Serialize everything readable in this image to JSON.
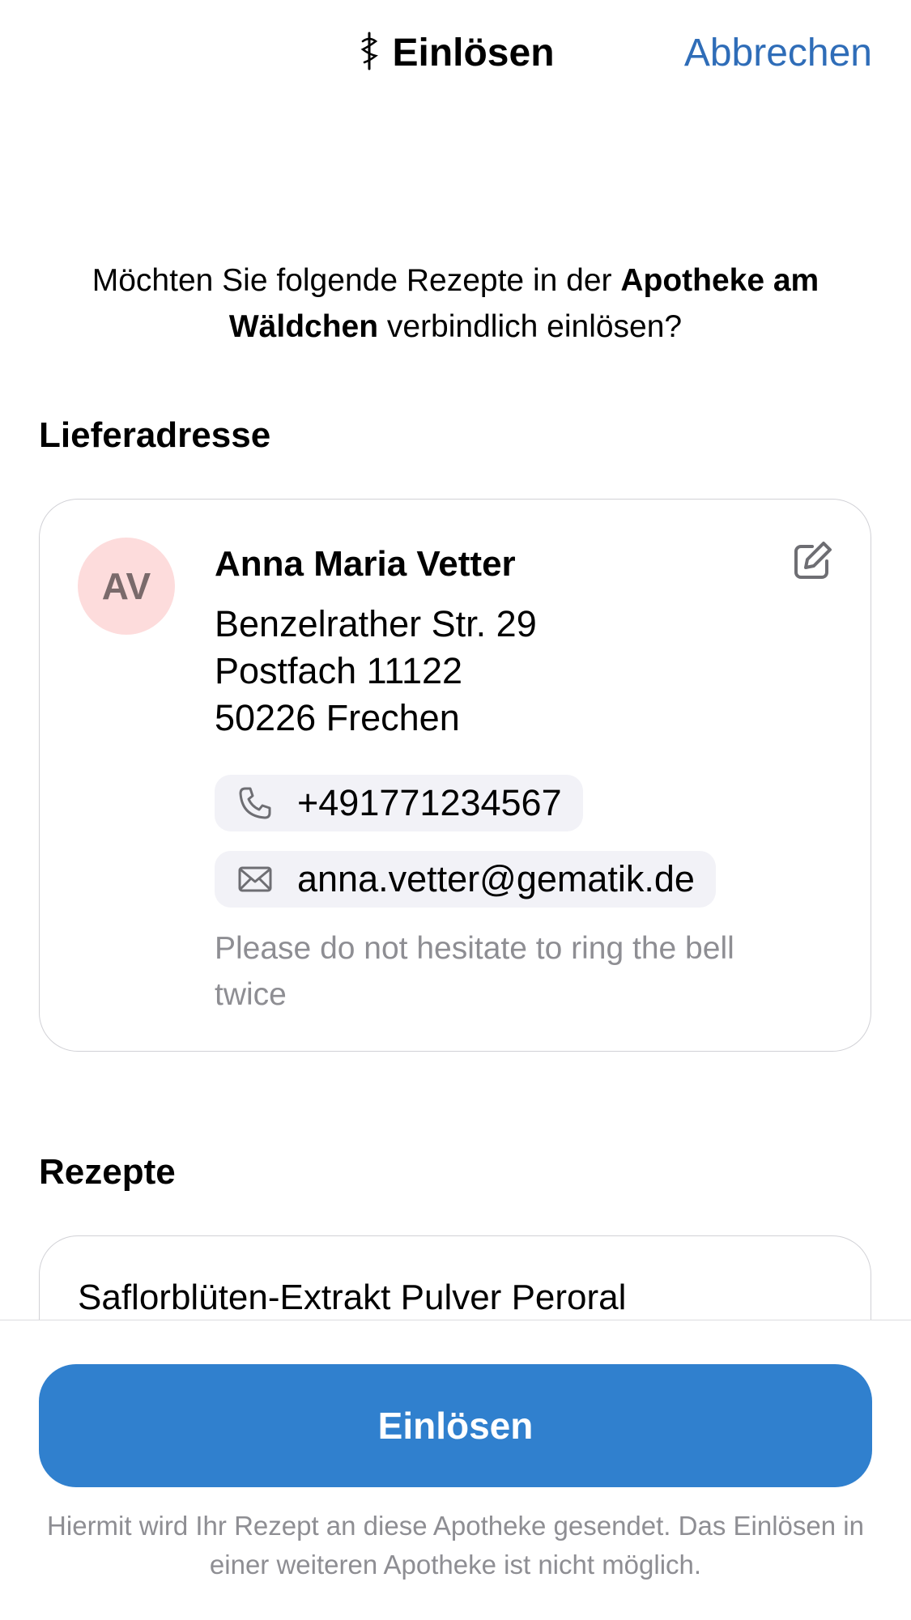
{
  "nav": {
    "title": "Einlösen",
    "cancel_label": "Abbrechen",
    "title_icon": "caduceus-icon"
  },
  "question": {
    "prefix": "Möchten Sie folgende Rezepte in der ",
    "pharmacy": "Apotheke am Wäldchen",
    "suffix": " verbindlich einlösen?"
  },
  "delivery": {
    "header": "Lieferadresse",
    "avatar_initials": "AV",
    "avatar_color": "#fddcdc",
    "name": "Anna Maria Vetter",
    "address_lines": [
      "Benzelrather Str. 29",
      "Postfach 11122",
      "50226  Frechen"
    ],
    "phone": "+491771234567",
    "email": "anna.vetter@gematik.de",
    "note": "Please do not hesitate to ring the bell twice",
    "edit_icon": "edit-icon"
  },
  "prescriptions": {
    "header": "Rezepte",
    "items": [
      "Saflorblüten-Extrakt Pulver Peroral"
    ]
  },
  "footer": {
    "button_label": "Einlösen",
    "button_color": "#3080ce",
    "disclaimer": "Hiermit wird Ihr Rezept an diese Apotheke gesendet. Das Einlösen in einer weiteren Apotheke ist nicht möglich."
  },
  "colors": {
    "accent": "#2f6db8",
    "secondary_text": "#8e8e93",
    "chip_background": "#f2f2f7"
  }
}
